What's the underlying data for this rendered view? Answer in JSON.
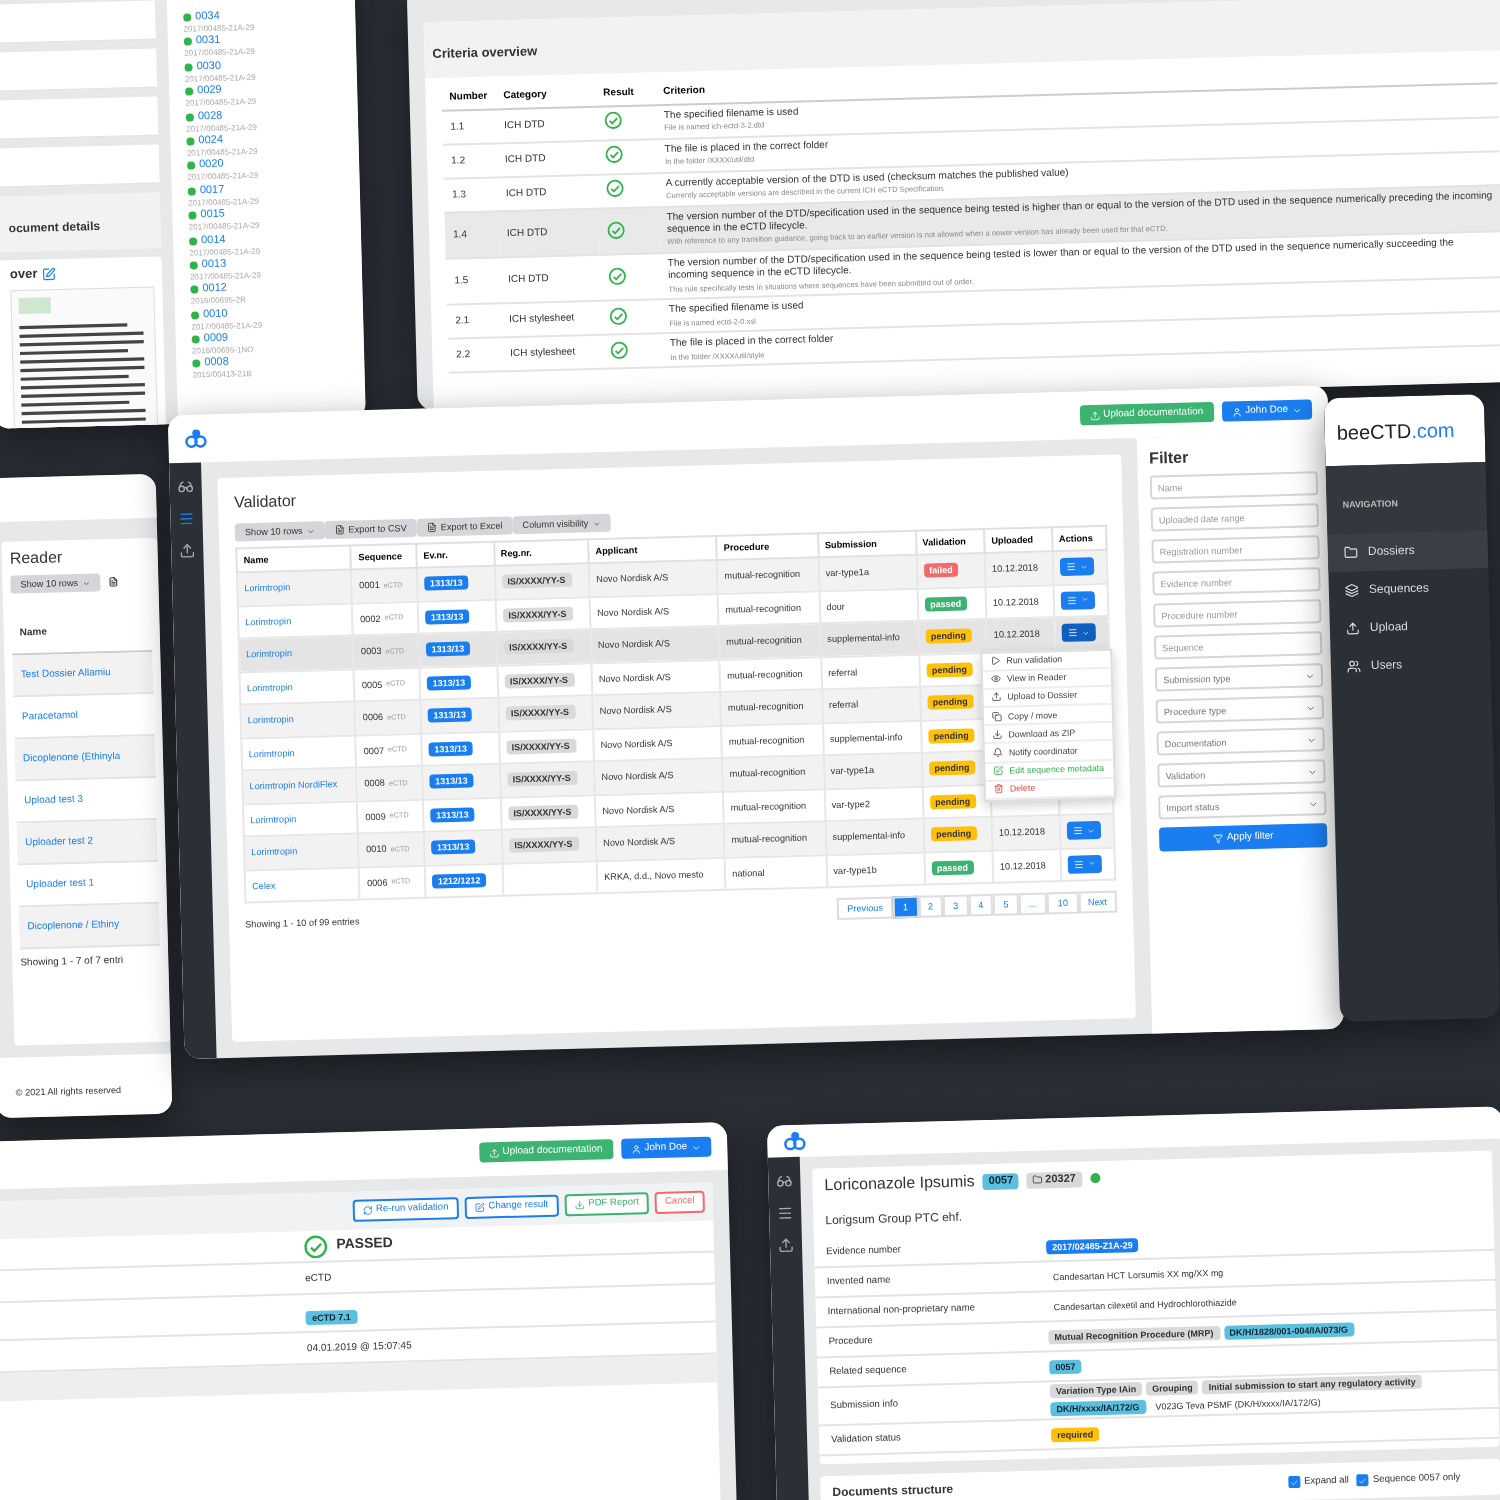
{
  "document_panel": {
    "title": "ocument details",
    "cover_label": "over",
    "sequences": [
      {
        "number": "0034",
        "id": "2017/00485-21A-29"
      },
      {
        "number": "0031",
        "id": "2017/00485-21A-29"
      },
      {
        "number": "0030",
        "id": "2017/00485-21A-29"
      },
      {
        "number": "0029",
        "id": "2017/00485-21A-29"
      },
      {
        "number": "0028",
        "id": "2017/00485-21A-29"
      },
      {
        "number": "0024",
        "id": "2017/00485-21A-29"
      },
      {
        "number": "0020",
        "id": "2017/00485-21A-29"
      },
      {
        "number": "0017",
        "id": "2017/00485-21A-29"
      },
      {
        "number": "0015",
        "id": "2017/00485-21A-29"
      },
      {
        "number": "0014",
        "id": "2017/00485-21A-29"
      },
      {
        "number": "0013",
        "id": "2017/00485-21A-29"
      },
      {
        "number": "0012",
        "id": "2016/00695-2R"
      },
      {
        "number": "0010",
        "id": "2017/00485-21A-29"
      },
      {
        "number": "0009",
        "id": "2016/00695-1NO"
      },
      {
        "number": "0008",
        "id": "2015/00413-21B"
      }
    ]
  },
  "criteria": {
    "title": "Criteria overview",
    "columns": [
      "Number",
      "Category",
      "Result",
      "Criterion"
    ],
    "rows": [
      {
        "number": "1.1",
        "category": "ICH DTD",
        "passed": true,
        "highlighted": false,
        "criterion": "The specified filename is used",
        "detail": "File is named ich-ectd-3-2.dtd"
      },
      {
        "number": "1.2",
        "category": "ICH DTD",
        "passed": true,
        "highlighted": false,
        "criterion": "The file is placed in the correct folder",
        "detail": "In the folder /XXXX/util/dtd"
      },
      {
        "number": "1.3",
        "category": "ICH DTD",
        "passed": true,
        "highlighted": false,
        "criterion": "A currently acceptable version of the DTD is used (checksum matches the published value)",
        "detail": "Currently acceptable versions are described in the current ICH eCTD Specification."
      },
      {
        "number": "1.4",
        "category": "ICH DTD",
        "passed": true,
        "highlighted": true,
        "criterion": "The version number of the DTD/specification used in the sequence being tested is higher than or equal to the version of the DTD used in the sequence numerically preceding the incoming sequence in the eCTD lifecycle.",
        "detail": "With reference to any transition guidance, going back to an earlier version is not allowed when a newer version has already been used for that eCTD."
      },
      {
        "number": "1.5",
        "category": "ICH DTD",
        "passed": true,
        "highlighted": false,
        "criterion": "The version number of the DTD/specification used in the sequence being tested is lower than or equal to the version of the DTD used in the sequence numerically succeeding the incoming sequence in the eCTD lifecycle.",
        "detail": "This rule specifically tests in situations where sequences have been submitted out of order."
      },
      {
        "number": "2.1",
        "category": "ICH stylesheet",
        "passed": true,
        "highlighted": false,
        "criterion": "The specified filename is used",
        "detail": "File is named ectd-2-0.xsl"
      },
      {
        "number": "2.2",
        "category": "ICH stylesheet",
        "passed": true,
        "highlighted": false,
        "criterion": "The file is placed in the correct folder",
        "detail": "In the folder /XXXX/util/style"
      }
    ]
  },
  "validator": {
    "upload_button": "Upload documentation",
    "user": "John Doe",
    "title": "Validator",
    "toolbar": [
      "Show 10 rows",
      "Export to CSV",
      "Export to Excel",
      "Column visibility"
    ],
    "columns": [
      "Name",
      "Sequence",
      "Ev.nr.",
      "Reg.nr.",
      "Applicant",
      "Procedure",
      "Submission",
      "Validation",
      "Uploaded",
      "Actions"
    ],
    "rows": [
      {
        "name": "Lorimtropin",
        "sequence": "0001",
        "format": "eCTD",
        "ev": "1313/13",
        "reg": "IS/XXXX/YY-S",
        "applicant": "Novo Nordisk A/S",
        "procedure": "mutual-recognition",
        "submission": "var-type1a",
        "validation": {
          "text": "failed",
          "kind": "danger"
        },
        "uploaded": "10.12.2018",
        "menu_open": false
      },
      {
        "name": "Lorimtropin",
        "sequence": "0002",
        "format": "eCTD",
        "ev": "1313/13",
        "reg": "IS/XXXX/YY-S",
        "applicant": "Novo Nordisk A/S",
        "procedure": "mutual-recognition",
        "submission": "dour",
        "validation": {
          "text": "passed",
          "kind": "success"
        },
        "uploaded": "10.12.2018",
        "menu_open": false
      },
      {
        "name": "Lorimtropin",
        "sequence": "0003",
        "format": "eCTD",
        "ev": "1313/13",
        "reg": "IS/XXXX/YY-S",
        "applicant": "Novo Nordisk A/S",
        "procedure": "mutual-recognition",
        "submission": "supplemental-info",
        "validation": {
          "text": "pending",
          "kind": "warning"
        },
        "uploaded": "10.12.2018",
        "menu_open": true
      },
      {
        "name": "Lorimtropin",
        "sequence": "0005",
        "format": "eCTD",
        "ev": "1313/13",
        "reg": "IS/XXXX/YY-S",
        "applicant": "Novo Nordisk A/S",
        "procedure": "mutual-recognition",
        "submission": "referral",
        "validation": {
          "text": "pending",
          "kind": "warning"
        },
        "menu_open": false
      },
      {
        "name": "Lorimtropin",
        "sequence": "0006",
        "format": "eCTD",
        "ev": "1313/13",
        "reg": "IS/XXXX/YY-S",
        "applicant": "Novo Nordisk A/S",
        "procedure": "mutual-recognition",
        "submission": "referral",
        "validation": {
          "text": "pending",
          "kind": "warning"
        },
        "menu_open": false
      },
      {
        "name": "Lorimtropin",
        "sequence": "0007",
        "format": "eCTD",
        "ev": "1313/13",
        "reg": "IS/XXXX/YY-S",
        "applicant": "Novo Nordisk A/S",
        "procedure": "mutual-recognition",
        "submission": "supplemental-info",
        "validation": {
          "text": "pending",
          "kind": "warning"
        },
        "menu_open": false
      },
      {
        "name": "Lorimtropin NordiFlex",
        "sequence": "0008",
        "format": "eCTD",
        "ev": "1313/13",
        "reg": "IS/XXXX/YY-S",
        "applicant": "Novo Nordisk A/S",
        "procedure": "mutual-recognition",
        "submission": "var-type1a",
        "validation": {
          "text": "pending",
          "kind": "warning"
        },
        "menu_open": false
      },
      {
        "name": "Lorimtropin",
        "sequence": "0009",
        "format": "eCTD",
        "ev": "1313/13",
        "reg": "IS/XXXX/YY-S",
        "applicant": "Novo Nordisk A/S",
        "procedure": "mutual-recognition",
        "submission": "var-type2",
        "validation": {
          "text": "pending",
          "kind": "warning"
        },
        "menu_open": false
      },
      {
        "name": "Lorimtropin",
        "sequence": "0010",
        "format": "eCTD",
        "ev": "1313/13",
        "reg": "IS/XXXX/YY-S",
        "applicant": "Novo Nordisk A/S",
        "procedure": "mutual-recognition",
        "submission": "supplemental-info",
        "validation": {
          "text": "pending",
          "kind": "warning"
        },
        "uploaded": "10.12.2018",
        "menu_open": false
      },
      {
        "name": "Celex",
        "sequence": "0006",
        "format": "eCTD",
        "ev": "1212/1212",
        "applicant": "KRKA, d.d., Novo mesto",
        "procedure": "national",
        "submission": "var-type1b",
        "validation": {
          "text": "passed",
          "kind": "success"
        },
        "uploaded": "10.12.2018",
        "menu_open": false
      }
    ],
    "menu": [
      {
        "label": "Run validation",
        "kind": "normal"
      },
      {
        "label": "View in Reader",
        "kind": "normal"
      },
      {
        "label": "Upload to Dossier",
        "kind": "normal"
      },
      {
        "label": "Copy / move",
        "kind": "normal"
      },
      {
        "label": "Download as ZIP",
        "kind": "normal"
      },
      {
        "label": "Notify coordinator",
        "kind": "normal"
      },
      {
        "label": "Edit sequence metadata",
        "kind": "edit"
      },
      {
        "label": "Delete",
        "kind": "danger"
      }
    ],
    "pagination": [
      {
        "label": "Previous",
        "selected": false
      },
      {
        "label": "1",
        "selected": true
      },
      {
        "label": "2",
        "selected": false
      },
      {
        "label": "3",
        "selected": false
      },
      {
        "label": "4",
        "selected": false
      },
      {
        "label": "5",
        "selected": false
      },
      {
        "label": "…",
        "selected": false
      },
      {
        "label": "10",
        "selected": false
      },
      {
        "label": "Next",
        "selected": false
      }
    ],
    "info": "Showing 1 - 10 of 99 entries",
    "filter": {
      "title": "Filter",
      "fields": [
        {
          "placeholder": "Name",
          "kind": "text"
        },
        {
          "placeholder": "Uploaded date range",
          "kind": "text"
        },
        {
          "placeholder": "Registration number",
          "kind": "text"
        },
        {
          "placeholder": "Evidence number",
          "kind": "text"
        },
        {
          "placeholder": "Procedure number",
          "kind": "text"
        },
        {
          "placeholder": "Sequence",
          "kind": "text"
        },
        {
          "placeholder": "Submission type",
          "kind": "select"
        },
        {
          "placeholder": "Procedure type",
          "kind": "select"
        },
        {
          "placeholder": "Documentation",
          "kind": "select"
        },
        {
          "placeholder": "Validation",
          "kind": "select"
        },
        {
          "placeholder": "Import status",
          "kind": "select"
        }
      ],
      "button": "Apply filter"
    }
  },
  "navigation": {
    "brand": "beeCTD",
    "brand_suffix": ".com",
    "heading": "NAVIGATION",
    "items": [
      {
        "label": "Dossiers",
        "selected": true
      },
      {
        "label": "Sequences",
        "selected": false
      },
      {
        "label": "Upload",
        "selected": false
      },
      {
        "label": "Users",
        "selected": false
      }
    ]
  },
  "reader": {
    "title": "Reader",
    "show_rows": "Show 10 rows",
    "column": "Name",
    "items": [
      "Test Dossier Allamiu",
      "Paracetamol",
      "Dicoplenone (Ethinyla",
      "Upload test 3",
      "Uploader test 2",
      "Uploader test 1",
      "Dicoplenone / Ethiny"
    ],
    "info": "Showing 1 - 7 of 7 entri",
    "footer": "© 2021 All rights reserved"
  },
  "result": {
    "upload_button": "Upload documentation",
    "user": "John Doe",
    "actions": [
      {
        "label": "Re-run validation",
        "kind": "primary"
      },
      {
        "label": "Change result",
        "kind": "primary"
      },
      {
        "label": "PDF Report",
        "kind": "success"
      },
      {
        "label": "Cancel",
        "kind": "danger"
      }
    ],
    "status": "PASSED",
    "passed": true,
    "format": "eCTD",
    "version": "eCTD 7.1",
    "date": "04.01.2019 @ 15:07:45"
  },
  "sequence": {
    "title": "Loriconazole Ipsumis",
    "number": "0057",
    "folder": "20327",
    "online": true,
    "company": "Lorigsum Group PTC ehf.",
    "rows": [
      {
        "label": "Evidence number",
        "values": [
          {
            "text": "2017/02485-Z1A-29",
            "kind": "primary"
          }
        ]
      },
      {
        "label": "Invented name",
        "values": [
          {
            "text": "Candesartan HCT Lorsumis XX mg/XX mg",
            "kind": "plain"
          }
        ]
      },
      {
        "label": "International non-proprietary name",
        "values": [
          {
            "text": "Candesartan cilexetil and Hydrochlorothiazide",
            "kind": "plain"
          }
        ]
      },
      {
        "label": "Procedure",
        "values": [
          {
            "text": "Mutual Recognition Procedure (MRP)",
            "kind": "grey"
          },
          {
            "text": "DK/H/1828/001-004/IA/073/G",
            "kind": "info"
          }
        ]
      },
      {
        "label": "Related sequence",
        "values": [
          {
            "text": "0057",
            "kind": "info"
          }
        ]
      },
      {
        "label": "Submission info",
        "values": [
          {
            "text": "Variation Type IAin",
            "kind": "grey"
          },
          {
            "text": "Grouping",
            "kind": "grey"
          },
          {
            "text": "Initial submission to start any regulatory activity",
            "kind": "grey"
          },
          {
            "text": "DK/H/xxxx/IA/172/G",
            "kind": "info"
          },
          {
            "text": "V023G Teva PSMF (DK/H/xxxx/IA/172/G)",
            "kind": "plain"
          }
        ]
      },
      {
        "label": "Validation status",
        "values": [
          {
            "text": "required",
            "kind": "warning"
          }
        ]
      }
    ],
    "structure_title": "Documents structure",
    "options": [
      {
        "label": "Expand all",
        "checked": true
      },
      {
        "label": "Sequence 0057 only",
        "checked": true
      }
    ]
  }
}
